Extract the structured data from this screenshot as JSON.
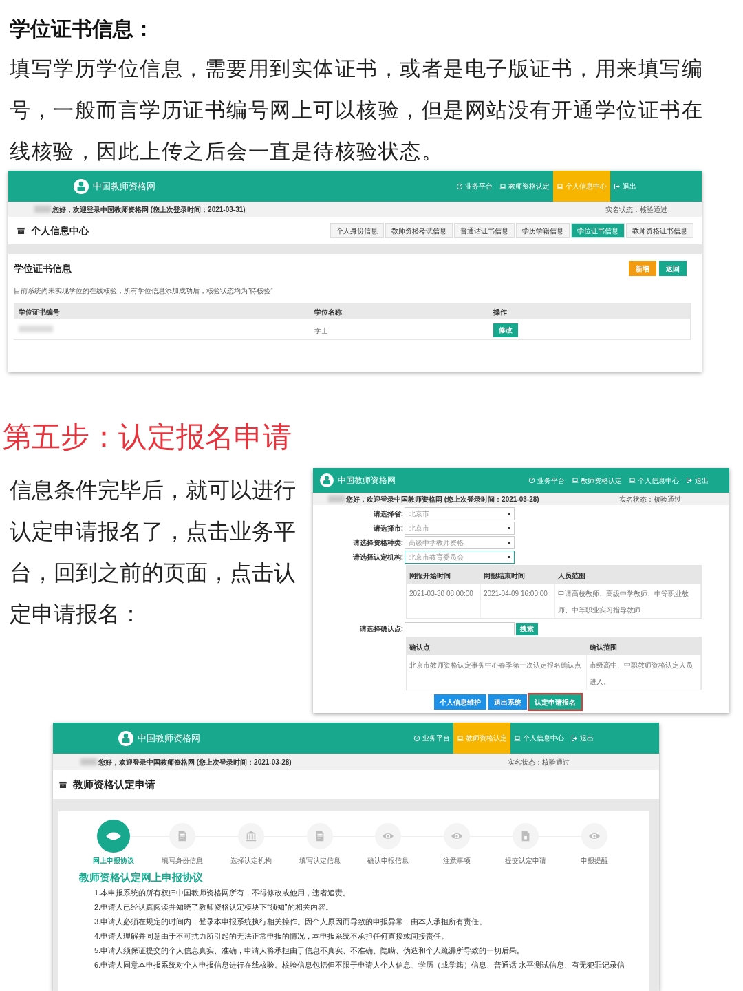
{
  "intro": {
    "heading": "学位证书信息：",
    "paragraph": "填写学历学位信息，需要用到实体证书，或者是电子版证书，用来填写编号，一般而言学历证书编号网上可以核验，但是网站没有开通学位证书在线核验，因此上传之后会一直是待核验状态。"
  },
  "screenshot_1": {
    "header": {
      "brand": "中国教师资格网",
      "nav": [
        {
          "label": "业务平台",
          "selected": false
        },
        {
          "label": "教师资格认定",
          "selected": false
        },
        {
          "label": "个人信息中心",
          "selected": true
        },
        {
          "label": "退出",
          "selected": false
        }
      ]
    },
    "welcome": "您好，欢迎登录中国教师资格网 (您上次登录时间：2021-03-31)",
    "status": "实名状态：核验通过",
    "page_title": "个人信息中心",
    "tabs": [
      {
        "label": "个人身份信息",
        "selected": false
      },
      {
        "label": "教师资格考试信息",
        "selected": false
      },
      {
        "label": "普通话证书信息",
        "selected": false
      },
      {
        "label": "学历学籍信息",
        "selected": false
      },
      {
        "label": "学位证书信息",
        "selected": true
      },
      {
        "label": "教师资格证书信息",
        "selected": false
      }
    ],
    "section_title": "学位证书信息",
    "actions": [
      {
        "label": "新增",
        "kind": "warning"
      },
      {
        "label": "返回",
        "kind": "primary"
      }
    ],
    "notice": "目前系统尚未实现学位的在线核验，所有学位信息添加成功后，核验状态均为“待核验”",
    "table": {
      "columns": [
        "学位证书编号",
        "学位名称",
        "操作"
      ],
      "rows": [
        {
          "degree": "学士",
          "action": "修改"
        }
      ]
    }
  },
  "step_title": "第五步：认定报名申请",
  "step_paragraph": "信息条件完毕后，就可以进行认定申请报名了，点击业务平台，回到之前的页面，点击认定申请报名：",
  "screenshot_2": {
    "header": {
      "brand": "中国教师资格网",
      "nav": [
        {
          "label": "业务平台",
          "selected": false
        },
        {
          "label": "教师资格认定",
          "selected": false
        },
        {
          "label": "个人信息中心",
          "selected": false
        },
        {
          "label": "退出",
          "selected": false
        }
      ]
    },
    "welcome": "您好，欢迎登录中国教师资格网 (您上次登录时间：2021-03-28)",
    "status": "实名状态：核验通过",
    "form": [
      {
        "label": "请选择省:",
        "value": "北京市",
        "focused": false
      },
      {
        "label": "请选择市:",
        "value": "北京市",
        "focused": false
      },
      {
        "label": "请选择资格种类:",
        "value": "高级中学教师资格",
        "focused": false
      },
      {
        "label": "请选择认定机构:",
        "value": "北京市教育委员会",
        "focused": true
      }
    ],
    "period_table": {
      "columns": [
        "网报开始时间",
        "网报结束时间",
        "人员范围"
      ],
      "rows": [
        [
          "2021-03-30 08:00:00",
          "2021-04-09 16:00:00",
          "申请高校教师、高级中学教师、中等职业教师、中等职业实习指导教师"
        ]
      ]
    },
    "confirm_search": {
      "label": "请选择确认点:",
      "button": "搜索"
    },
    "confirm_table": {
      "columns": [
        "确认点",
        "确认范围"
      ],
      "rows": [
        [
          "北京市教师资格认定事务中心春季第一次认定报名确认点",
          "市级高中、中职教师资格认定人员进入。"
        ]
      ]
    },
    "buttons": [
      {
        "label": "个人信息维护",
        "highlighted": false
      },
      {
        "label": "退出系统",
        "highlighted": false
      },
      {
        "label": "认定申请报名",
        "highlighted": true
      }
    ]
  },
  "screenshot_3": {
    "header": {
      "brand": "中国教师资格网",
      "nav": [
        {
          "label": "业务平台",
          "selected": false
        },
        {
          "label": "教师资格认定",
          "selected": true
        },
        {
          "label": "个人信息中心",
          "selected": false
        },
        {
          "label": "退出",
          "selected": false
        }
      ]
    },
    "welcome": "您好，欢迎登录中国教师资格网 (您上次登录时间：2021-03-28)",
    "status": "实名状态：核验通过",
    "page_title": "教师资格认定申请",
    "steps": [
      {
        "label": "网上申报协议",
        "selected": true
      },
      {
        "label": "填写身份信息",
        "selected": false
      },
      {
        "label": "选择认定机构",
        "selected": false
      },
      {
        "label": "填写认定信息",
        "selected": false
      },
      {
        "label": "确认申报信息",
        "selected": false
      },
      {
        "label": "注意事项",
        "selected": false
      },
      {
        "label": "提交认定申请",
        "selected": false
      },
      {
        "label": "申报提醒",
        "selected": false
      }
    ],
    "agreement_title": "教师资格认定网上申报协议",
    "agreement_items": [
      "1.本申报系统的所有权归中国教师资格网所有，不得修改或他用，违者追责。",
      "2.申请人已经认真阅读并知晓了教师资格认定模块下“须知”的相关内容。",
      "3.申请人必须在规定的时间内，登录本申报系统执行相关操作。因个人原因而导致的申报异常，由本人承担所有责任。",
      "4.申请人理解并同意由于不可抗力所引起的无法正常申报的情况，本申报系统不承担任何直接或间接责任。",
      "5.申请人须保证提交的个人信息真实、准确，申请人将承担由于信息不真实、不准确、隐瞒、伪造和个人疏漏所导致的一切后果。",
      "6.申请人同意本申报系统对个人申报信息进行在线核验。核验信息包括但不限于申请人个人信息、学历（或学籍）信息、普通话 水平测试信息、有无犯罪记录信"
    ]
  }
}
